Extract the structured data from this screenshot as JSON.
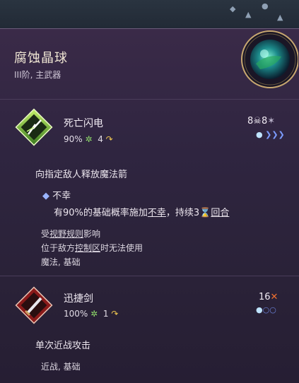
{
  "item": {
    "name": "腐蚀晶球",
    "subtitle": "III阶, 主武器"
  },
  "skills": [
    {
      "name": "死亡闪电",
      "chance": "90%",
      "ap": "4",
      "cost_value_1": "8",
      "cost_value_2": "8",
      "description": "向指定敌人释放魔法箭",
      "status_name": "不幸",
      "status_text_pre": "有90%的基础概率施加",
      "status_link": "不幸",
      "status_text_mid": "，持续3",
      "status_duration": "回合",
      "note_1_pre": "受",
      "note_1_link": "视野规则",
      "note_1_post": "影响",
      "note_2_pre": "位于敌方",
      "note_2_link": "控制区",
      "note_2_post": "时无法使用",
      "tags": "魔法, 基础"
    },
    {
      "name": "迅捷剑",
      "chance": "100%",
      "ap": "1",
      "cost_value": "16",
      "description": "单次近战攻击",
      "tags": "近战, 基础"
    }
  ],
  "colors": {
    "accent_green": "#8fdc6a",
    "accent_yellow": "#f0c850",
    "panel_bg": "#2f2540",
    "link_blue": "#9ab4ff"
  }
}
